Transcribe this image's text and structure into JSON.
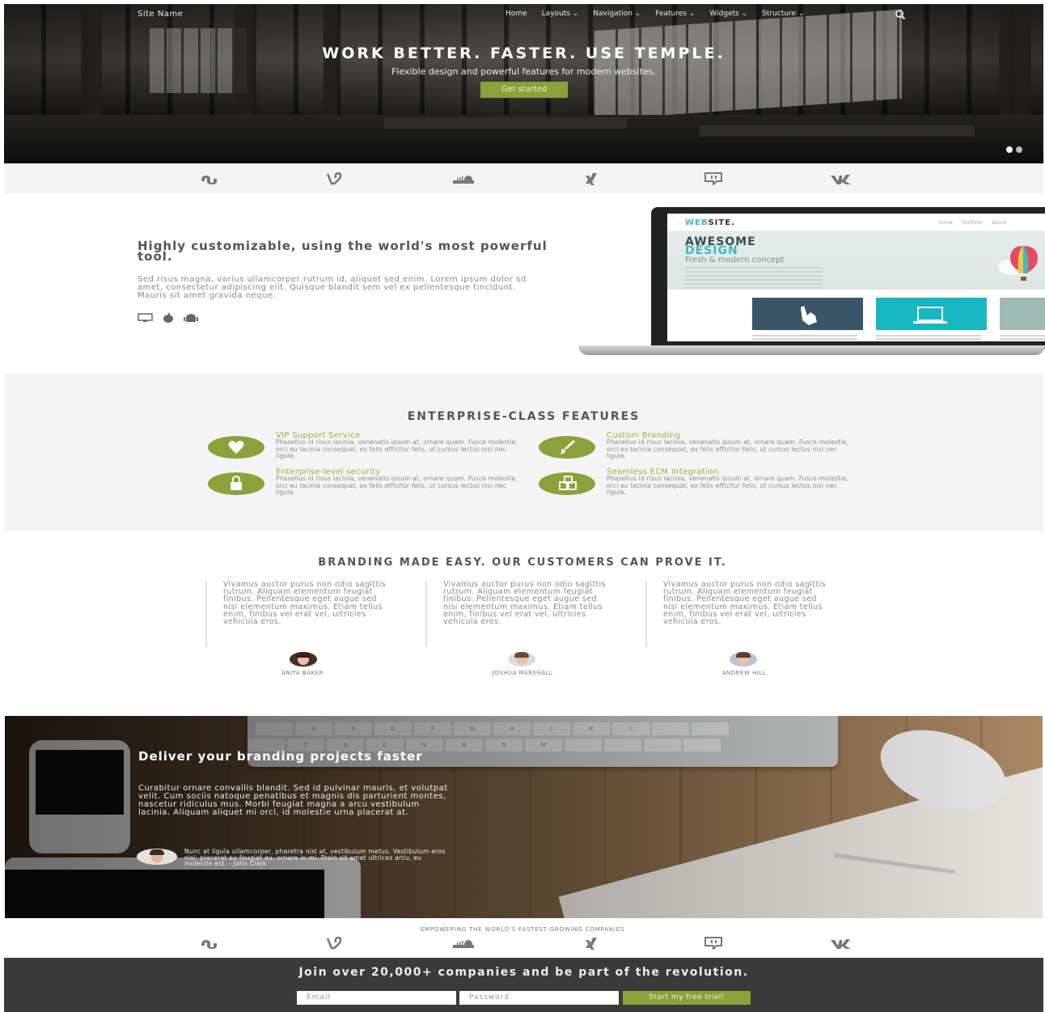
{
  "nav": {
    "site_name": "Site Name",
    "links": [
      "Home",
      "Layouts ⌄",
      "Navigation ⌄",
      "Features ⌄",
      "Widgets ⌄",
      "Structure ⌄"
    ],
    "search_icon": "search-icon"
  },
  "hero": {
    "title": "WORK BETTER. FASTER. USE TEMPLE.",
    "subtitle": "Flexible design and powerful features for modern websites.",
    "button": "Get started",
    "accent": "#8ba13a"
  },
  "logos": [
    "stumbleupon-icon",
    "vine-icon",
    "soundcloud-icon",
    "xing-icon",
    "twitch-icon",
    "vk-icon"
  ],
  "intro": {
    "title": "Highly customizable, using the world's most powerful tool.",
    "text": "Sed risus magna, varius ullamcorper rutrum id, aliquet sed enim. Lorem ipsum dolor sit amet, consectetur adipiscing elit. Quisque blandit sem vel ex pellentesque tincidunt. Mauris sit amet gravida neque.",
    "platform_icons": [
      "desktop-icon",
      "apple-icon",
      "android-icon"
    ]
  },
  "mockup": {
    "logo_a": "WEB",
    "logo_b": "SITE.",
    "nav": [
      "Home",
      "Portfolio",
      "About"
    ],
    "h1_a": "AWESOME",
    "h1_b": "DESIGN",
    "h2": "Fresh & modern concept"
  },
  "enterprise": {
    "title": "ENTERPRISE-CLASS FEATURES",
    "features": [
      {
        "title": "VIP Support Service",
        "text": "Phasellus id risus lacinia, venenatis ipsum at, ornare quam. Fusce molestie, orci eu lacinia consequat, ex felis efficitur felis, ut cursus lectus nisi nec ligula.",
        "icon": "heart-icon"
      },
      {
        "title": "Custom Branding",
        "text": "Phasellus id risus lacinia, venenatis ipsum at, ornare quam. Fusce molestie, orci eu lacinia consequat, ex felis efficitur felis, ut cursus lectus nisi nec ligula.",
        "icon": "brush-icon"
      },
      {
        "title": "Enterprise-level security",
        "text": "Phasellus id risus lacinia, venenatis ipsum at, ornare quam. Fusce molestie, orci eu lacinia consequat, ex felis efficitur felis, ut cursus lectus nisi nec ligula.",
        "icon": "lock-icon"
      },
      {
        "title": "Seamless ECM Integration",
        "text": "Phasellus id risus lacinia, venenatis ipsum at, ornare quam. Fusce molestie, orci eu lacinia consequat, ex felis efficitur felis, ut cursus lectus nisi nec ligula.",
        "icon": "cubes-icon"
      }
    ]
  },
  "testimonials": {
    "title": "BRANDING MADE EASY. OUR CUSTOMERS CAN PROVE IT.",
    "items": [
      {
        "text": "Vivamus auctor purus non odio sagittis rutrum. Aliquam elementum feugiat finibus. Pellentesque eget augue sed nisi elementum maximus. Etiam tellus enim, finibus vel erat vel, ultricies vehicula eros.",
        "name": "ANITA BAKER"
      },
      {
        "text": "Vivamus auctor purus non odio sagittis rutrum. Aliquam elementum feugiat finibus. Pellentesque eget augue sed nisi elementum maximus. Etiam tellus enim, finibus vel erat vel, ultricies vehicula eros.",
        "name": "JOSHUA MARSHALL"
      },
      {
        "text": "Vivamus auctor purus non odio sagittis rutrum. Aliquam elementum feugiat finibus. Pellentesque eget augue sed nisi elementum maximus. Etiam tellus enim, finibus vel erat vel, ultricies vehicula eros.",
        "name": "ANDREW HILL"
      }
    ]
  },
  "desk": {
    "title": "Deliver your branding projects faster",
    "text": "Curabitur ornare convallis blandit. Sed id pulvinar mauris, et volutpat velit. Cum sociis natoque penatibus et magnis dis parturient montes, nascetur ridiculus mus. Morbi feugiat magna a arcu vestibulum lacinia. Aliquam aliquet mi orci, id molestie urna placerat at.",
    "quote": "Nunc at ligula ullamcorper, pharetra nisl at, vestibulum metus. Vestibulum eros nisl, placerat eu feugiat eu, ornare in mi. Proin sit amet ultrices arcu, eu molestie est. - John Clark",
    "keys_row1": [
      "",
      "A",
      "S",
      "D",
      "F",
      "G",
      "H",
      "J",
      "K",
      "L",
      "",
      ""
    ],
    "keys_row2": [
      "",
      "Z",
      "X",
      "C",
      "V",
      "B",
      "N",
      "M",
      "",
      "",
      "",
      ""
    ]
  },
  "empower": "EMPOWERING THE WORLD'S FASTEST-GROWING COMPANIES",
  "cta": {
    "title": "Join over 20,000+ companies and be part of the revolution.",
    "email_placeholder": "Email",
    "password_placeholder": "Password",
    "button": "Start my free trial!"
  }
}
